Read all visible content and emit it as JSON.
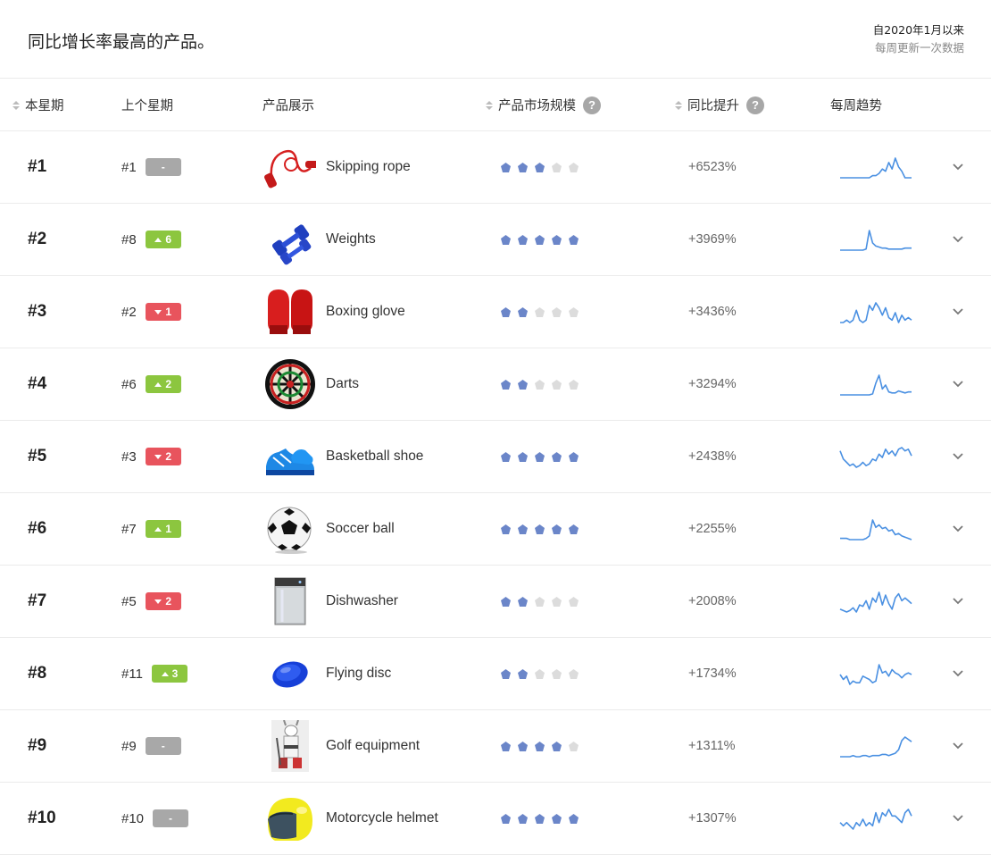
{
  "header": {
    "title": "同比增长率最高的产品。",
    "since": "自2020年1月以来",
    "frequency": "每周更新一次数据"
  },
  "columns": {
    "this_week": "本星期",
    "last_week": "上个星期",
    "product": "产品展示",
    "market_size": "产品市场规模",
    "yoy": "同比提升",
    "trend": "每周趋势"
  },
  "colors": {
    "accent_blue": "#6b86c9",
    "trend_line": "#4a90e2",
    "badge_up": "#8cc63f",
    "badge_down": "#e8545d",
    "badge_none": "#a8a8a8"
  },
  "rows": [
    {
      "rank": "#1",
      "prev": "#1",
      "change_dir": "none",
      "change": "-",
      "name": "Skipping rope",
      "icon": "skipping-rope-icon",
      "stars": 3,
      "growth": "+6523%",
      "trend": [
        2,
        2,
        2,
        2,
        2,
        2,
        2,
        2,
        2,
        2,
        3,
        3,
        4,
        6,
        5,
        9,
        6,
        11,
        7,
        5,
        2,
        2,
        2
      ]
    },
    {
      "rank": "#2",
      "prev": "#8",
      "change_dir": "up",
      "change": "6",
      "name": "Weights",
      "icon": "dumbbell-icon",
      "stars": 5,
      "growth": "+3969%",
      "trend": [
        1,
        1,
        1,
        1,
        1,
        1,
        1,
        1,
        2,
        20,
        8,
        5,
        4,
        3,
        3,
        2,
        2,
        2,
        2,
        2,
        3,
        3,
        3
      ]
    },
    {
      "rank": "#3",
      "prev": "#2",
      "change_dir": "down",
      "change": "1",
      "name": "Boxing glove",
      "icon": "boxing-glove-icon",
      "stars": 2,
      "growth": "+3436%",
      "trend": [
        3,
        3,
        4,
        3,
        4,
        8,
        4,
        3,
        4,
        10,
        8,
        11,
        9,
        6,
        9,
        5,
        4,
        7,
        3,
        6,
        4,
        5,
        4
      ]
    },
    {
      "rank": "#4",
      "prev": "#6",
      "change_dir": "up",
      "change": "2",
      "name": "Darts",
      "icon": "dartboard-icon",
      "stars": 2,
      "growth": "+3294%",
      "trend": [
        2,
        2,
        2,
        2,
        2,
        2,
        2,
        2,
        2,
        2,
        3,
        14,
        22,
        8,
        12,
        5,
        4,
        4,
        6,
        5,
        4,
        5,
        5
      ]
    },
    {
      "rank": "#5",
      "prev": "#3",
      "change_dir": "down",
      "change": "2",
      "name": "Basketball shoe",
      "icon": "basketball-shoe-icon",
      "stars": 5,
      "growth": "+2438%",
      "trend": [
        12,
        7,
        5,
        3,
        4,
        2,
        3,
        5,
        3,
        4,
        7,
        6,
        10,
        8,
        13,
        10,
        12,
        9,
        13,
        14,
        12,
        13,
        9
      ]
    },
    {
      "rank": "#6",
      "prev": "#7",
      "change_dir": "up",
      "change": "1",
      "name": "Soccer ball",
      "icon": "soccer-ball-icon",
      "stars": 5,
      "growth": "+2255%",
      "trend": [
        3,
        3,
        3,
        2,
        2,
        2,
        2,
        2,
        3,
        5,
        18,
        12,
        14,
        11,
        12,
        9,
        10,
        6,
        7,
        5,
        4,
        3,
        2
      ]
    },
    {
      "rank": "#7",
      "prev": "#5",
      "change_dir": "down",
      "change": "2",
      "name": "Dishwasher",
      "icon": "dishwasher-icon",
      "stars": 2,
      "growth": "+2008%",
      "trend": [
        4,
        3,
        2,
        3,
        5,
        2,
        7,
        6,
        10,
        4,
        12,
        9,
        16,
        7,
        14,
        8,
        4,
        12,
        15,
        10,
        12,
        10,
        8
      ]
    },
    {
      "rank": "#8",
      "prev": "#11",
      "change_dir": "up",
      "change": "3",
      "name": "Flying disc",
      "icon": "flying-disc-icon",
      "stars": 2,
      "growth": "+1734%",
      "trend": [
        8,
        5,
        7,
        2,
        4,
        3,
        3,
        7,
        6,
        5,
        3,
        4,
        14,
        9,
        10,
        7,
        11,
        9,
        8,
        6,
        8,
        9,
        8
      ]
    },
    {
      "rank": "#9",
      "prev": "#9",
      "change_dir": "none",
      "change": "-",
      "name": "Golf equipment",
      "icon": "golf-equipment-icon",
      "stars": 4,
      "growth": "+1311%",
      "trend": [
        2,
        2,
        2,
        2,
        3,
        2,
        2,
        3,
        3,
        2,
        3,
        3,
        3,
        4,
        4,
        3,
        4,
        5,
        8,
        16,
        19,
        17,
        15
      ]
    },
    {
      "rank": "#10",
      "prev": "#10",
      "change_dir": "none",
      "change": "-",
      "name": "Motorcycle helmet",
      "icon": "motorcycle-helmet-icon",
      "stars": 5,
      "growth": "+1307%",
      "trend": [
        4,
        3,
        4,
        3,
        2,
        4,
        3,
        5,
        3,
        4,
        3,
        7,
        4,
        7,
        6,
        8,
        6,
        6,
        5,
        4,
        7,
        8,
        6
      ]
    }
  ]
}
